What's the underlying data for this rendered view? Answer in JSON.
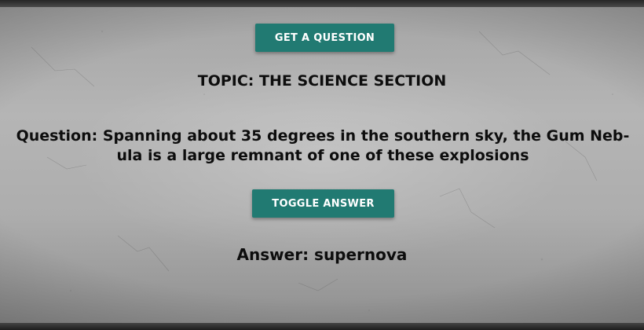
{
  "buttons": {
    "get_question": "GET A QUESTION",
    "toggle_answer": "TOGGLE ANSWER"
  },
  "topic": "TOPIC: THE SCIENCE SECTION",
  "question": "Question: Spanning about 35 degrees in the southern sky, the Gum Neb-ula is a large remnant of one of these explosions",
  "answer": "Answer: supernova",
  "colors": {
    "button": "#217a72",
    "button_text": "#ffffff",
    "text": "#0d0d0d",
    "background": "#adadad"
  }
}
